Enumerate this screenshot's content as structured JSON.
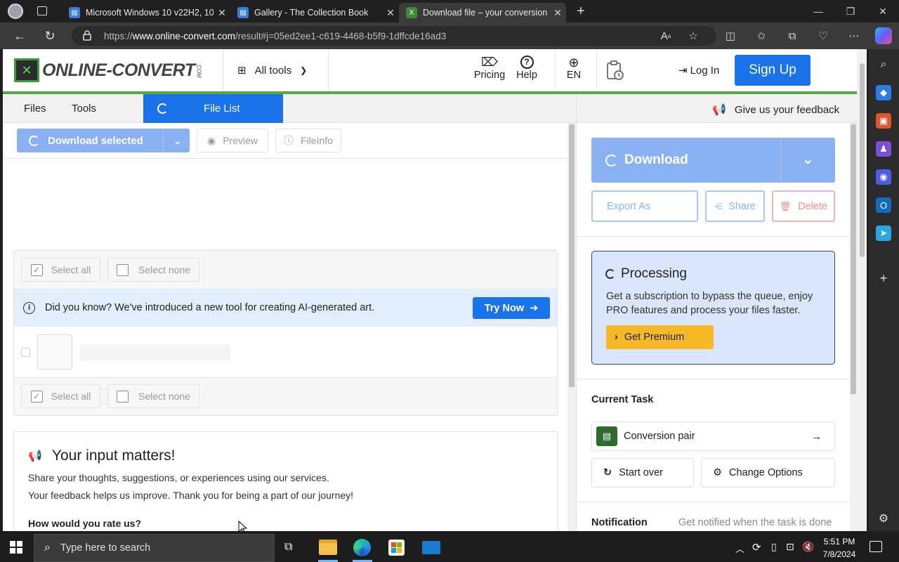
{
  "browser": {
    "tabs": [
      {
        "label": "Microsoft Windows 10 v22H2, 10",
        "active": false,
        "icon": "document-icon"
      },
      {
        "label": "Gallery - The Collection Book",
        "active": false,
        "icon": "document-icon"
      },
      {
        "label": "Download file – your conversion",
        "active": true,
        "icon": "online-convert-icon"
      }
    ],
    "url_prefix": "https://",
    "url_domain": "www.online-convert.com",
    "url_path": "/result#j=05ed2ee1-c619-4468-b5f9-1dffcde16ad3"
  },
  "header": {
    "logo_text": "ONLINE-CONVERT",
    "logo_com": ".COM",
    "all_tools": "All tools",
    "pricing": "Pricing",
    "help": "Help",
    "language": "EN",
    "login": "Log In",
    "signup": "Sign Up",
    "accent": "#1a73e8",
    "brand_green": "#4caf50"
  },
  "tabs_bar": {
    "files": "Files",
    "tools": "Tools",
    "file_list": "File List",
    "feedback": "Give us your feedback"
  },
  "toolbar": {
    "download_selected": "Download selected",
    "preview": "Preview",
    "fileinfo": "FileInfo"
  },
  "filelist": {
    "select_all": "Select all",
    "select_none": "Select none",
    "notice": "Did you know? We've introduced a new tool for creating AI-generated art.",
    "try_now": "Try Now"
  },
  "input_card": {
    "title": "Your input matters!",
    "line1": "Share your thoughts, suggestions, or experiences using our services.",
    "line2": "Your feedback helps us improve. Thank you for being a part of our journey!",
    "rate": "How would you rate us?"
  },
  "right_panel": {
    "download": "Download",
    "export_as": "Export As",
    "share": "Share",
    "delete": "Delete",
    "processing_title": "Processing",
    "processing_text": "Get a subscription to bypass the queue, enjoy PRO features and process your files faster.",
    "get_premium": "Get Premium",
    "current_task": "Current Task",
    "conversion_pair": "Conversion pair",
    "start_over": "Start over",
    "change_options": "Change Options",
    "notification": "Notification",
    "notification_text": "Get notified when the task is done"
  },
  "taskbar": {
    "search_placeholder": "Type here to search",
    "time": "5:51 PM",
    "date": "7/8/2024"
  }
}
